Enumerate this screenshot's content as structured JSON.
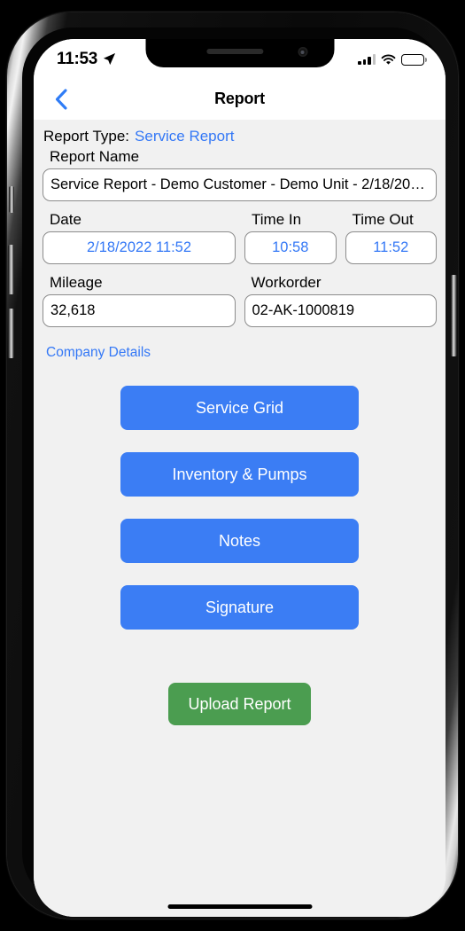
{
  "status_bar": {
    "time": "11:53",
    "location_icon": "location-arrow-icon",
    "signal_icon": "cellular-signal-icon",
    "wifi_icon": "wifi-icon",
    "battery_icon": "battery-full-icon"
  },
  "nav_bar": {
    "back_icon": "chevron-left-icon",
    "title": "Report"
  },
  "form": {
    "report_type_label": "Report Type:",
    "report_type_value": "Service Report",
    "report_name_label": "Report Name",
    "report_name_value": "Service Report - Demo Customer - Demo Unit - 2/18/202…",
    "date_label": "Date",
    "date_value": "2/18/2022 11:52",
    "time_in_label": "Time In",
    "time_in_value": "10:58",
    "time_out_label": "Time Out",
    "time_out_value": "11:52",
    "mileage_label": "Mileage",
    "mileage_value": "32,618",
    "workorder_label": "Workorder",
    "workorder_value": "02-AK-1000819",
    "company_details_link": "Company Details"
  },
  "actions": {
    "primary_buttons": [
      {
        "label": "Service Grid"
      },
      {
        "label": "Inventory & Pumps"
      },
      {
        "label": "Notes"
      },
      {
        "label": "Signature"
      }
    ],
    "upload_label": "Upload Report"
  },
  "colors": {
    "accent_blue": "#3478f6",
    "button_blue": "#3b7df4",
    "upload_green": "#4b9d50",
    "screen_background": "#f1f1f1",
    "field_border": "#8c8c8c"
  }
}
